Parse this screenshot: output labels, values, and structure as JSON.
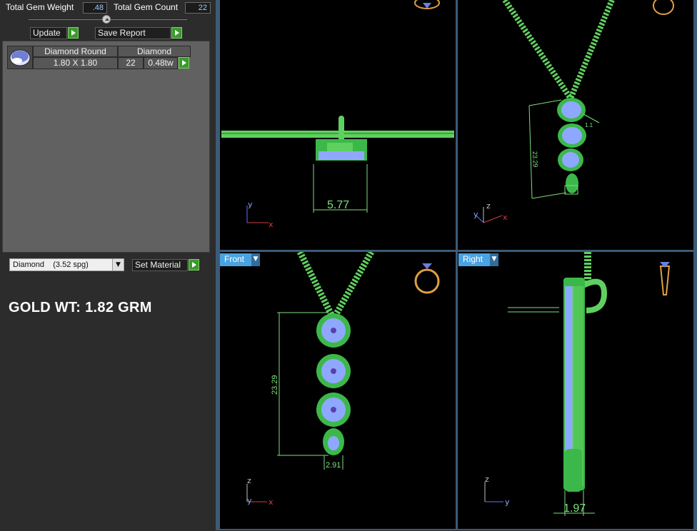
{
  "stats": {
    "gem_weight_label": "Total Gem Weight",
    "gem_weight_value": ".48",
    "gem_count_label": "Total Gem Count",
    "gem_count_value": "22"
  },
  "actions": {
    "update_label": "Update",
    "save_report_label": "Save Report",
    "set_material_label": "Set Material"
  },
  "gem_table": {
    "headers": [
      "Diamond Round",
      "Diamond"
    ],
    "rows": [
      {
        "size": "1.80 X 1.80",
        "count": "22",
        "weight": "0.48tw"
      }
    ]
  },
  "material": {
    "selected": "Diamond    (3.52 spg)"
  },
  "gold_weight": "GOLD WT: 1.82 GRM",
  "viewports": {
    "top_left": {
      "dimension": "5.77"
    },
    "top_right": {
      "dimension": "23.29",
      "small_dimension": "1.1"
    },
    "bottom_left": {
      "label": "Front",
      "dimension_height": "23.29",
      "dimension_width": "2.91"
    },
    "bottom_right": {
      "label": "Right",
      "dimension": "1.97"
    }
  },
  "axes": {
    "x": "x",
    "y": "y",
    "z": "z"
  },
  "colors": {
    "accent": "#4aa3e0",
    "wire_green": "#5fd05f",
    "gem_blue": "#8fa8ff",
    "go_green": "#3a9a2c"
  }
}
